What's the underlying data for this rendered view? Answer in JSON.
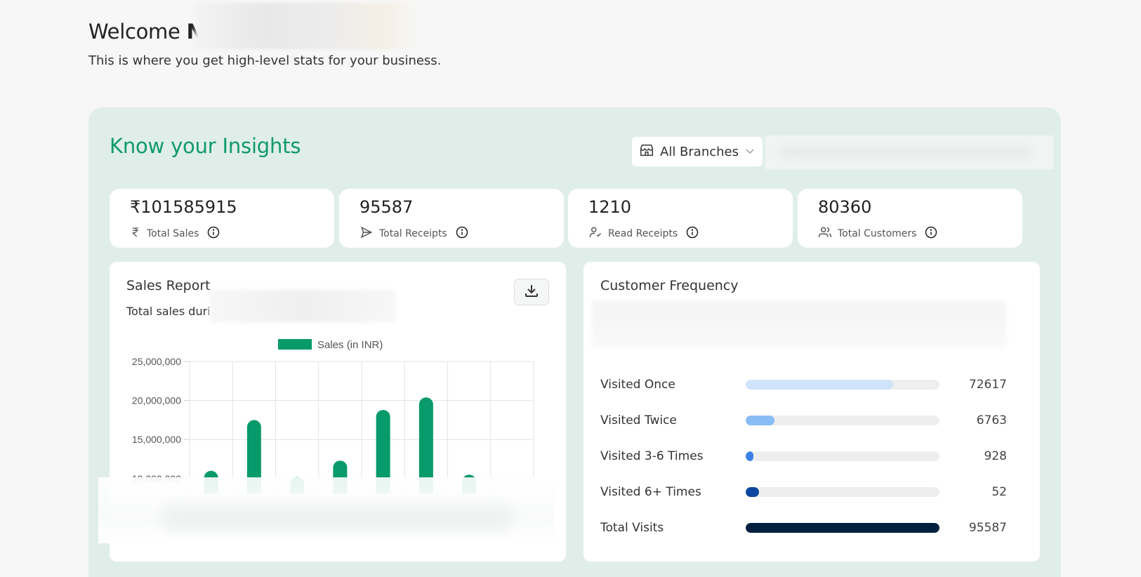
{
  "header": {
    "welcome": "Welcome",
    "first_initial": "N",
    "subtitle": "This is where you get high-level stats for your business."
  },
  "insights": {
    "title": "Know your Insights",
    "branch_selector": {
      "selected": "All Branches"
    }
  },
  "stats": [
    {
      "value": "₹101585915",
      "label": "Total Sales",
      "icon": "rupee-icon"
    },
    {
      "value": "95587",
      "label": "Total Receipts",
      "icon": "send-icon"
    },
    {
      "value": "1210",
      "label": "Read Receipts",
      "icon": "user-check-icon"
    },
    {
      "value": "80360",
      "label": "Total Customers",
      "icon": "users-icon"
    }
  ],
  "sales_report": {
    "title": "Sales Report",
    "subtitle": "Total sales duri"
  },
  "chart_data": {
    "type": "bar",
    "legend": "Sales (in INR)",
    "legend_position": "top",
    "bar_color": "#089a6b",
    "y_ticks": [
      "25,000,000",
      "20,000,000",
      "15,000,000",
      "10,000,000",
      "5,000,000"
    ],
    "ylim": [
      0,
      25000000
    ],
    "grid": true,
    "series": [
      {
        "name": "Sales (in INR)",
        "values": [
          11000000,
          17500000,
          10200000,
          12300000,
          18800000,
          20400000,
          10500000
        ]
      }
    ]
  },
  "customer_frequency": {
    "title": "Customer Frequency",
    "rows": [
      {
        "label": "Visited Once",
        "count": "72617",
        "fraction": 0.76,
        "color": "#cfe4fb"
      },
      {
        "label": "Visited Twice",
        "count": "6763",
        "fraction": 0.15,
        "color": "#88bdf6"
      },
      {
        "label": "Visited 3-6 Times",
        "count": "928",
        "fraction": 0.04,
        "color": "#3c82e6"
      },
      {
        "label": "Visited 6+ Times",
        "count": "52",
        "fraction": 0.07,
        "color": "#0d47a1"
      },
      {
        "label": "Total Visits",
        "count": "95587",
        "fraction": 1.0,
        "color": "#00203f"
      }
    ]
  }
}
